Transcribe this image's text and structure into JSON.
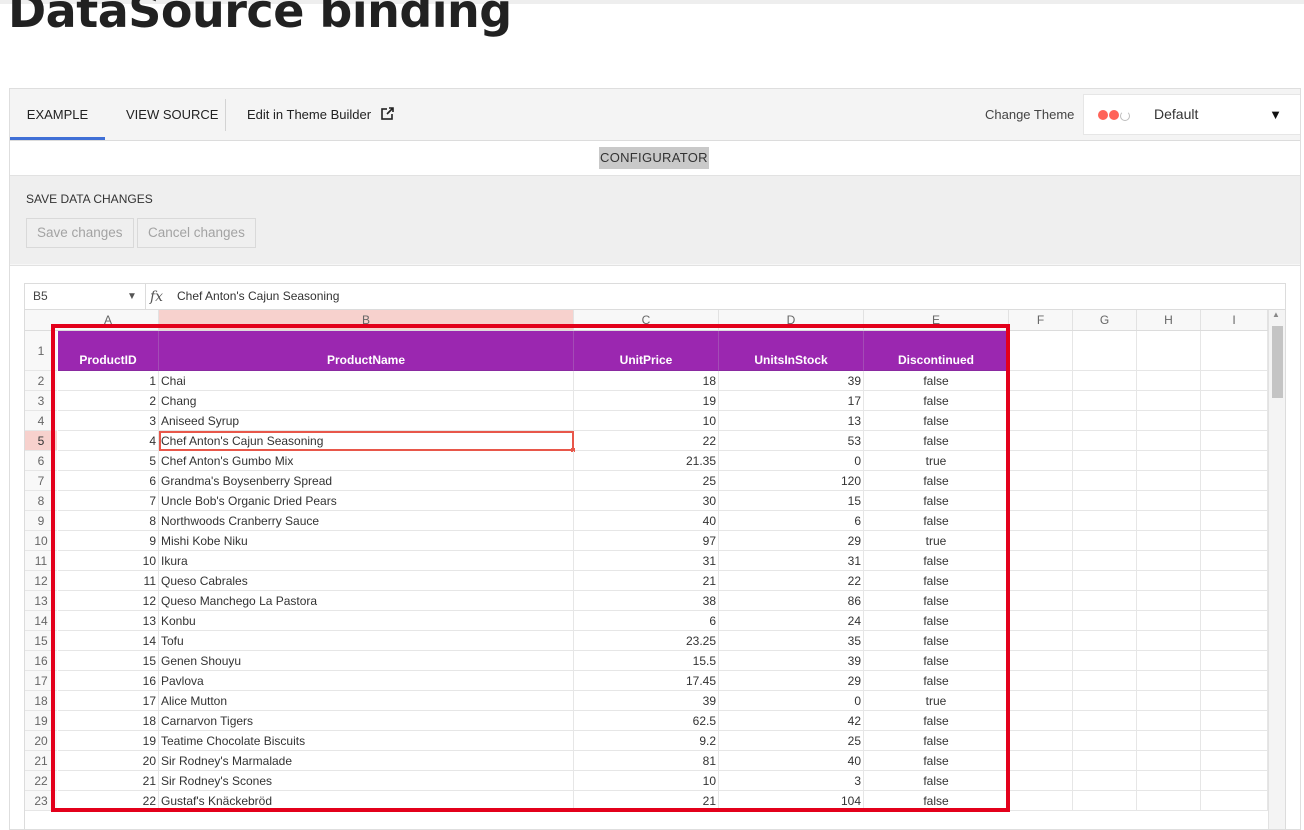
{
  "page": {
    "title": "DataSource binding"
  },
  "tabs": {
    "example": "EXAMPLE",
    "view_source": "VIEW SOURCE",
    "theme_builder": "Edit in Theme Builder"
  },
  "theme": {
    "label": "Change Theme",
    "value": "Default"
  },
  "configurator": {
    "label": "CONFIGURATOR"
  },
  "save_section": {
    "title": "SAVE DATA CHANGES",
    "save_button": "Save changes",
    "cancel_button": "Cancel changes"
  },
  "formula_bar": {
    "cell_ref": "B5",
    "fx": "fx",
    "value": "Chef Anton's Cajun Seasoning"
  },
  "columns": [
    "A",
    "B",
    "C",
    "D",
    "E",
    "F",
    "G",
    "H",
    "I"
  ],
  "selected_cell": {
    "row": 5,
    "column": "B"
  },
  "table_headers": [
    "ProductID",
    "ProductName",
    "UnitPrice",
    "UnitsInStock",
    "Discontinued"
  ],
  "rows": [
    {
      "num": "2",
      "cells": [
        "1",
        "Chai",
        "18",
        "39",
        "false"
      ]
    },
    {
      "num": "3",
      "cells": [
        "2",
        "Chang",
        "19",
        "17",
        "false"
      ]
    },
    {
      "num": "4",
      "cells": [
        "3",
        "Aniseed Syrup",
        "10",
        "13",
        "false"
      ]
    },
    {
      "num": "5",
      "cells": [
        "4",
        "Chef Anton's Cajun Seasoning",
        "22",
        "53",
        "false"
      ]
    },
    {
      "num": "6",
      "cells": [
        "5",
        "Chef Anton's Gumbo Mix",
        "21.35",
        "0",
        "true"
      ]
    },
    {
      "num": "7",
      "cells": [
        "6",
        "Grandma's Boysenberry Spread",
        "25",
        "120",
        "false"
      ]
    },
    {
      "num": "8",
      "cells": [
        "7",
        "Uncle Bob's Organic Dried Pears",
        "30",
        "15",
        "false"
      ]
    },
    {
      "num": "9",
      "cells": [
        "8",
        "Northwoods Cranberry Sauce",
        "40",
        "6",
        "false"
      ]
    },
    {
      "num": "10",
      "cells": [
        "9",
        "Mishi Kobe Niku",
        "97",
        "29",
        "true"
      ]
    },
    {
      "num": "11",
      "cells": [
        "10",
        "Ikura",
        "31",
        "31",
        "false"
      ]
    },
    {
      "num": "12",
      "cells": [
        "11",
        "Queso Cabrales",
        "21",
        "22",
        "false"
      ]
    },
    {
      "num": "13",
      "cells": [
        "12",
        "Queso Manchego La Pastora",
        "38",
        "86",
        "false"
      ]
    },
    {
      "num": "14",
      "cells": [
        "13",
        "Konbu",
        "6",
        "24",
        "false"
      ]
    },
    {
      "num": "15",
      "cells": [
        "14",
        "Tofu",
        "23.25",
        "35",
        "false"
      ]
    },
    {
      "num": "16",
      "cells": [
        "15",
        "Genen Shouyu",
        "15.5",
        "39",
        "false"
      ]
    },
    {
      "num": "17",
      "cells": [
        "16",
        "Pavlova",
        "17.45",
        "29",
        "false"
      ]
    },
    {
      "num": "18",
      "cells": [
        "17",
        "Alice Mutton",
        "39",
        "0",
        "true"
      ]
    },
    {
      "num": "19",
      "cells": [
        "18",
        "Carnarvon Tigers",
        "62.5",
        "42",
        "false"
      ]
    },
    {
      "num": "20",
      "cells": [
        "19",
        "Teatime Chocolate Biscuits",
        "9.2",
        "25",
        "false"
      ]
    },
    {
      "num": "21",
      "cells": [
        "20",
        "Sir Rodney's Marmalade",
        "81",
        "40",
        "false"
      ]
    },
    {
      "num": "22",
      "cells": [
        "21",
        "Sir Rodney's Scones",
        "10",
        "3",
        "false"
      ]
    },
    {
      "num": "23",
      "cells": [
        "22",
        "Gustaf's Knäckebröd",
        "21",
        "104",
        "false"
      ]
    }
  ],
  "colors": {
    "header_bg": "#9b27b0",
    "selection": "#e8574a",
    "annotation": "#e3001b",
    "active_tab": "#3f6fd6"
  }
}
